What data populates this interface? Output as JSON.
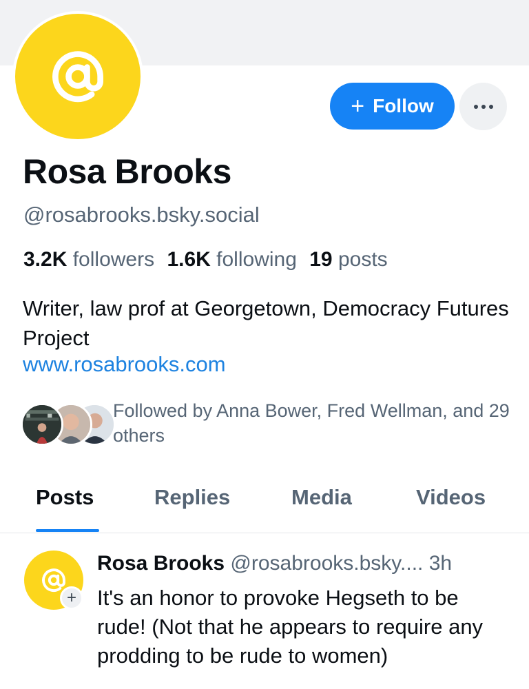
{
  "profile": {
    "display_name": "Rosa Brooks",
    "handle": "@rosabrooks.bsky.social",
    "avatar_icon": "at-sign-icon",
    "avatar_color": "#fcd61c"
  },
  "actions": {
    "follow_label": "Follow",
    "follow_icon": "plus-icon",
    "more_icon": "ellipsis-icon",
    "accent_color": "#1683f5"
  },
  "stats": {
    "followers_count": "3.2K",
    "followers_label": "followers",
    "following_count": "1.6K",
    "following_label": "following",
    "posts_count": "19",
    "posts_label": "posts"
  },
  "bio": {
    "text": "Writer, law prof at Georgetown, Democracy Futures Project",
    "link": "www.rosabrooks.com"
  },
  "followed_by": {
    "text": "Followed by Anna Bower, Fred Wellman, and 29 others"
  },
  "tabs": [
    {
      "label": "Posts",
      "active": true
    },
    {
      "label": "Replies",
      "active": false
    },
    {
      "label": "Media",
      "active": false
    },
    {
      "label": "Videos",
      "active": false
    }
  ],
  "post": {
    "author_name": "Rosa Brooks",
    "author_handle": "@rosabrooks.bsky....",
    "time": "3h",
    "body": "It's an honor to provoke Hegseth to be rude! (Not that he appears to require any prodding to be rude to women)"
  }
}
